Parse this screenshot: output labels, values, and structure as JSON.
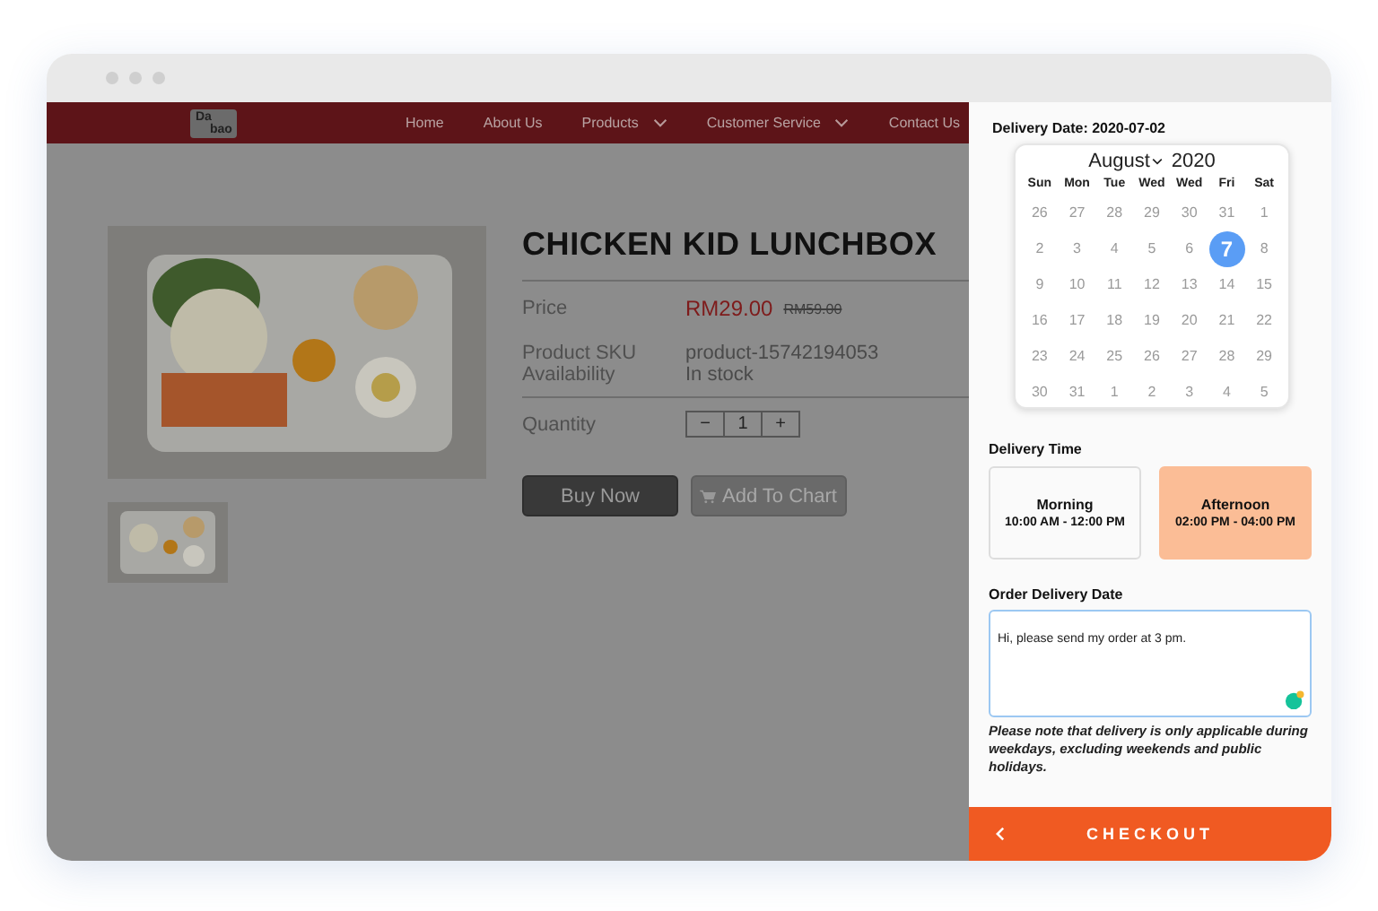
{
  "nav": {
    "logo": [
      "Da",
      "bao"
    ],
    "items": [
      {
        "label": "Home",
        "dropdown": false
      },
      {
        "label": "About Us",
        "dropdown": false
      },
      {
        "label": "Products",
        "dropdown": true
      },
      {
        "label": "Customer Service",
        "dropdown": true
      },
      {
        "label": "Contact Us",
        "dropdown": false
      }
    ]
  },
  "product": {
    "title": "CHICKEN KID LUNCHBOX",
    "price_label": "Price",
    "price": "RM29.00",
    "old_price": "RM59.00",
    "sku_label": "Product SKU",
    "sku": "product-15742194053",
    "availability_label": "Availability",
    "availability": "In stock",
    "quantity_label": "Quantity",
    "quantity": {
      "minus": "−",
      "value": "1",
      "plus": "+"
    },
    "buy_now": "Buy Now",
    "add_to_cart": "Add To Chart"
  },
  "panel": {
    "delivery_date": "Delivery Date: 2020-07-02",
    "calendar": {
      "month": "August",
      "year": "2020",
      "weekdays": [
        "Sun",
        "Mon",
        "Tue",
        "Wed",
        "Wed",
        "Fri",
        "Sat"
      ],
      "weeks": [
        [
          {
            "label": "26",
            "selected": false
          },
          {
            "label": "27",
            "selected": false
          },
          {
            "label": "28",
            "selected": false
          },
          {
            "label": "29",
            "selected": false
          },
          {
            "label": "30",
            "selected": false
          },
          {
            "label": "31",
            "selected": false
          },
          {
            "label": "1",
            "selected": false
          }
        ],
        [
          {
            "label": "2",
            "selected": false
          },
          {
            "label": "3",
            "selected": false
          },
          {
            "label": "4",
            "selected": false
          },
          {
            "label": "5",
            "selected": false
          },
          {
            "label": "6",
            "selected": false
          },
          {
            "label": "7",
            "selected": true
          },
          {
            "label": "8",
            "selected": false
          }
        ],
        [
          {
            "label": "9",
            "selected": false
          },
          {
            "label": "10",
            "selected": false
          },
          {
            "label": "11",
            "selected": false
          },
          {
            "label": "12",
            "selected": false
          },
          {
            "label": "13",
            "selected": false
          },
          {
            "label": "14",
            "selected": false
          },
          {
            "label": "15",
            "selected": false
          }
        ],
        [
          {
            "label": "16",
            "selected": false
          },
          {
            "label": "17",
            "selected": false
          },
          {
            "label": "18",
            "selected": false
          },
          {
            "label": "19",
            "selected": false
          },
          {
            "label": "20",
            "selected": false
          },
          {
            "label": "21",
            "selected": false
          },
          {
            "label": "22",
            "selected": false
          }
        ],
        [
          {
            "label": "23",
            "selected": false
          },
          {
            "label": "24",
            "selected": false
          },
          {
            "label": "25",
            "selected": false
          },
          {
            "label": "26",
            "selected": false
          },
          {
            "label": "27",
            "selected": false
          },
          {
            "label": "28",
            "selected": false
          },
          {
            "label": "29",
            "selected": false
          }
        ],
        [
          {
            "label": "30",
            "selected": false
          },
          {
            "label": "31",
            "selected": false
          },
          {
            "label": "1",
            "selected": false
          },
          {
            "label": "2",
            "selected": false
          },
          {
            "label": "3",
            "selected": false
          },
          {
            "label": "4",
            "selected": false
          },
          {
            "label": "5",
            "selected": false
          }
        ]
      ]
    },
    "delivery_time_label": "Delivery Time",
    "slots": [
      {
        "name": "Morning",
        "time": "10:00 AM - 12:00 PM",
        "selected": false
      },
      {
        "name": "Afternoon",
        "time": "02:00 PM - 04:00 PM",
        "selected": true
      }
    ],
    "note_label": "Order Delivery Date",
    "note_value": "Hi, please send my order at 3 pm.",
    "disclaimer": "Please note that delivery is only applicable during weekdays, excluding weekends and public holidays.",
    "checkout": "CHECKOUT"
  }
}
